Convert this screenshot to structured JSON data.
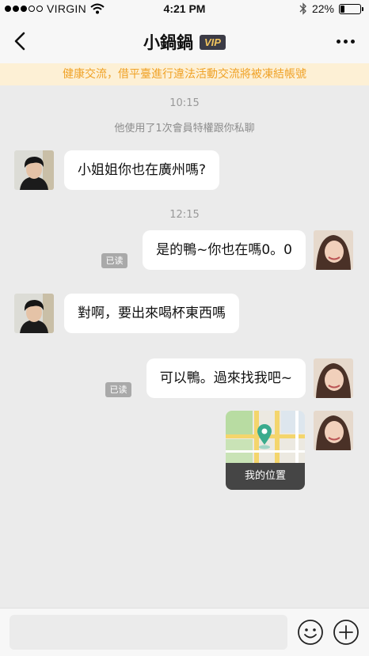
{
  "status_bar": {
    "carrier": "VIRGIN",
    "time": "4:21 PM",
    "battery": "22%",
    "battery_level": 0.22
  },
  "nav": {
    "title": "小鍋鍋",
    "badge": "VIP"
  },
  "notice": "健康交流，借平臺進行違法活動交流將被凍結帳號",
  "chat": {
    "timestamps": [
      "10:15",
      "12:15"
    ],
    "system_message": "他使用了1次會員特權跟你私聊",
    "messages": [
      {
        "from": "other",
        "text": "小姐姐你也在廣州嗎?"
      },
      {
        "from": "me",
        "text": "是的鴨~你也在嗎0。0",
        "status": "已读"
      },
      {
        "from": "other",
        "text": "對啊，要出來喝杯東西嗎"
      },
      {
        "from": "me",
        "text": "可以鴨。過來找我吧~",
        "status": "已读"
      }
    ],
    "location_card": {
      "label": "我的位置"
    }
  },
  "input_bar": {
    "value": "",
    "placeholder": ""
  },
  "colors": {
    "notice_bg": "#fdf0d5",
    "notice_text": "#f0a227",
    "chat_bg": "#ebebeb",
    "vip_bg": "#3b3b46",
    "vip_text": "#f2c45e",
    "map_pin": "#3aab8d"
  }
}
